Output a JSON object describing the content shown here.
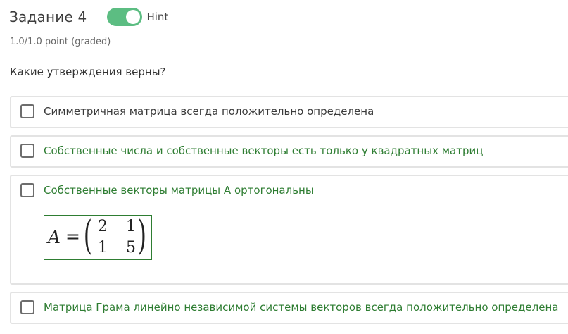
{
  "header": {
    "title": "Задание 4",
    "hint_label": "Hint",
    "hint_enabled": true
  },
  "points": "1.0/1.0 point (graded)",
  "question": "Какие утверждения верны?",
  "options": [
    {
      "text": "Симметричная матрица всегда положительно определена",
      "checked": false
    },
    {
      "text": "Собственные числа и собственные векторы есть только у квадратных матриц",
      "checked": false
    },
    {
      "text": "Собственные векторы матрицы A ортогональны",
      "checked": false
    },
    {
      "text": "Матрица Грама линейно независимой системы векторов всегда положительно определена",
      "checked": false
    }
  ],
  "formula": {
    "lhs": "A",
    "eq": "=",
    "left_paren": "(",
    "right_paren": ")",
    "matrix": [
      [
        "2",
        "1"
      ],
      [
        "1",
        "5"
      ]
    ]
  },
  "colors": {
    "toggle": "#5cbd82",
    "correct_text": "#2e7d32",
    "border": "#e3e3e3"
  }
}
